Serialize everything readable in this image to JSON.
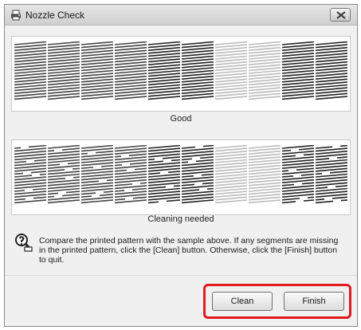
{
  "window": {
    "title": "Nozzle Check",
    "title_icon": "printer-icon",
    "close_icon": "close-icon"
  },
  "patterns": {
    "good_caption": "Good",
    "cleaning_caption": "Cleaning needed"
  },
  "message": {
    "icon": "help-icon",
    "text": "Compare the printed pattern with the sample above. If any segments are missing in the printed pattern, click the [Clean] button. Otherwise, click the [Finish] button to quit."
  },
  "buttons": {
    "clean_label": "Clean",
    "finish_label": "Finish"
  },
  "colors": {
    "highlight": "#e1191e"
  }
}
